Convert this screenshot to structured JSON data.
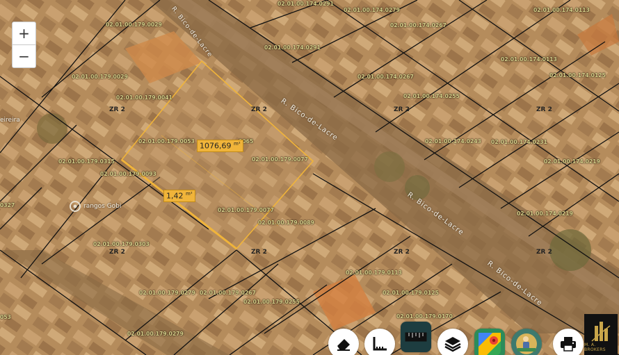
{
  "map": {
    "parcel_labels": [
      "02.01.00.174.0291",
      "02.01.00.174.0279",
      "02.01.00.174.0113",
      "02.01.00.179.0029",
      "02.01.00.174.0267",
      "02.01.00.174.0291",
      "02.01.00.174.0113",
      "02.01.00.179.0029",
      "02.01.00.174.0267",
      "02.01.00.174.0125",
      "02.01.00.179.0041",
      "02.01.00.174.0255",
      "02.01.00.179.0053",
      "0065",
      "02.01.00.174.0243",
      "02.01.00.174.0231",
      "02.01.00.179.0077",
      "02.01.00.174.0219",
      "02.01.00.179.0315",
      "02.01.00.179.0093",
      "02.01.00.174.0219",
      "02.01.00.179.0077",
      "02.01.00.179.0089",
      "02.01.00.179.0303",
      "02.01.00.179.0113",
      "02.01.00.179.0279",
      "02.01.00.179.0267",
      "02.01.00.179.0255",
      "02.01.00.179.0125",
      "02.01.00.179.0170",
      "02.01.00.179.0279"
    ],
    "partial_labels": [
      "0327",
      "053"
    ],
    "zones": [
      "ZR 2",
      "ZR 2",
      "ZR 2",
      "ZR 2",
      "ZR 2",
      "ZR 2",
      "ZR 2",
      "ZR 2"
    ],
    "streets": [
      "R. Bico-de-Lacre",
      "R. Bico-de-Lacre",
      "R. Bico-de-Lacre"
    ],
    "poi": {
      "name": "rangos Gobi",
      "partial_left": "eireira"
    },
    "measurements": {
      "area": "1076,69",
      "area_unit": "m²",
      "edge": "1,42",
      "edge_unit": "m²"
    },
    "colors": {
      "parcel_line": "#111111",
      "selection": "#f0b43a",
      "label": "#d8d08a"
    }
  },
  "zoom": {
    "in": "+",
    "out": "−"
  },
  "toolbar": {
    "tools": [
      "eraser-icon",
      "measure-area-icon",
      "ruler-icon",
      "layers-icon",
      "google-maps-icon",
      "street-view-icon",
      "print-icon"
    ]
  },
  "logo": {
    "text": "M. A. BROKERS"
  }
}
